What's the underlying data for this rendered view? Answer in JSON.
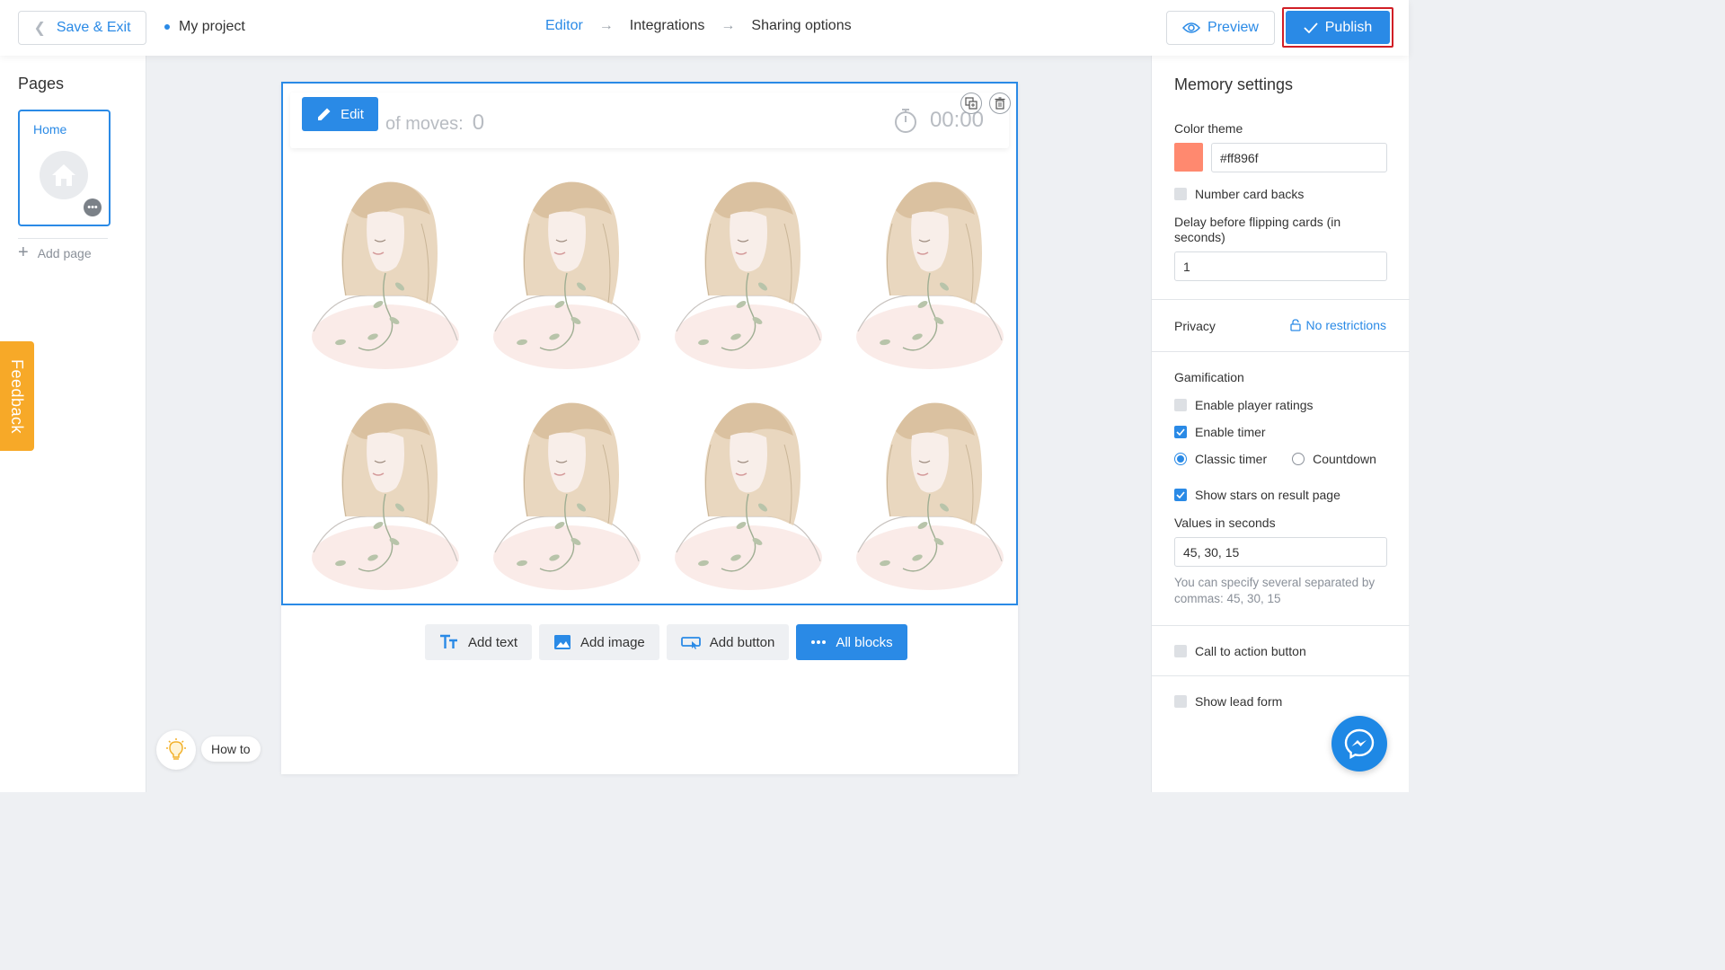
{
  "header": {
    "save_exit": "Save & Exit",
    "project_name": "My project",
    "steps": [
      "Editor",
      "Integrations",
      "Sharing options"
    ],
    "preview": "Preview",
    "publish": "Publish"
  },
  "pages": {
    "title": "Pages",
    "items": [
      {
        "label": "Home"
      }
    ],
    "add_page": "Add page"
  },
  "feedback": "Feedback",
  "howto": "How to",
  "game": {
    "moves_label": "of moves:",
    "moves_value": "0",
    "timer_value": "00:00",
    "edit": "Edit"
  },
  "toolbar": {
    "add_text": "Add text",
    "add_image": "Add image",
    "add_button": "Add button",
    "all_blocks": "All blocks"
  },
  "settings": {
    "title": "Memory settings",
    "color_theme_label": "Color theme",
    "color_value": "#ff896f",
    "number_card_backs": "Number card backs",
    "delay_label": "Delay before flipping cards (in seconds)",
    "delay_value": "1",
    "privacy_label": "Privacy",
    "privacy_value": "No restrictions",
    "gamification_label": "Gamification",
    "enable_ratings": "Enable player ratings",
    "enable_timer": "Enable timer",
    "classic_timer": "Classic timer",
    "countdown": "Countdown",
    "show_stars": "Show stars on result page",
    "values_label": "Values in seconds",
    "values_value": "45, 30, 15",
    "values_hint": "You can specify several separated by commas: 45, 30, 15",
    "cta_button": "Call to action button",
    "lead_form": "Show lead form"
  },
  "colors": {
    "accent": "#2a8ae6",
    "theme": "#ff896f",
    "feedback": "#f7a928",
    "highlight_border": "#d11f26"
  }
}
